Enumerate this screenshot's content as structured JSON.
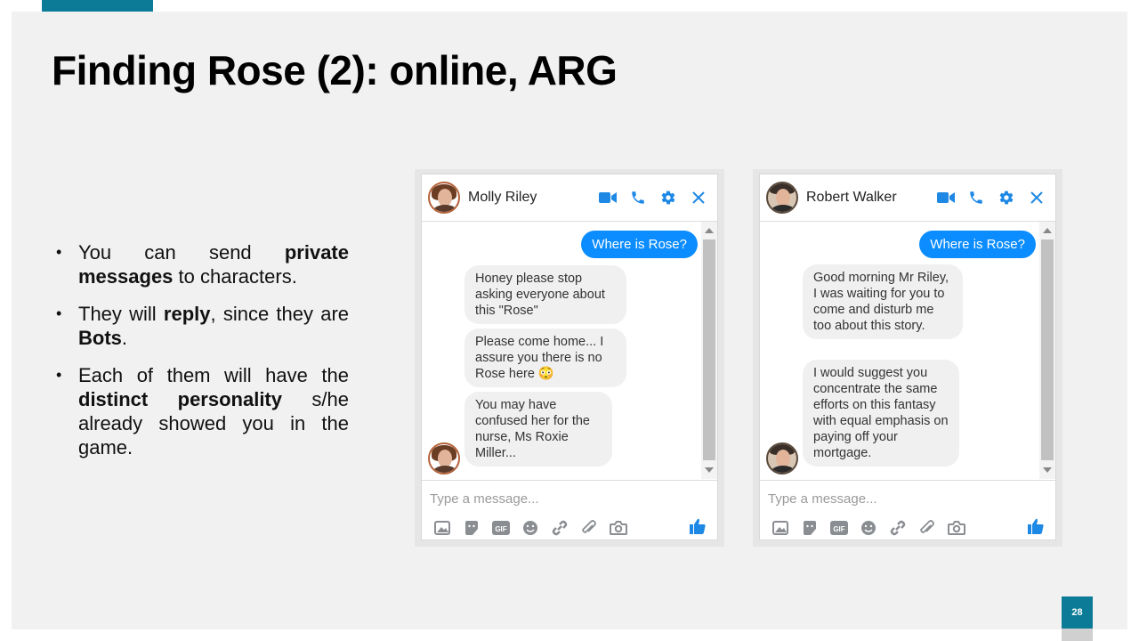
{
  "slide": {
    "title": "Finding Rose (2): online, ARG",
    "page_number": "28",
    "accent_color": "#0b7b97"
  },
  "bullets": [
    {
      "pre": "You can send ",
      "bold": "private messages",
      "post": " to characters."
    },
    {
      "pre": "They will ",
      "bold": "reply",
      "post": ", since they are ",
      "bold2": "Bots",
      "post2": "."
    },
    {
      "pre": "Each of them will have the ",
      "bold": "distinct personality",
      "post": " s/he already showed you in the game."
    }
  ],
  "chats": [
    {
      "contact": "Molly Riley",
      "outgoing": "Where is Rose?",
      "replies": [
        "Honey please stop asking everyone about this \"Rose\"",
        "Please come home... I assure you there is no Rose here 😳",
        "You may have confused her for the nurse, Ms Roxie Miller..."
      ],
      "placeholder": "Type a message...",
      "header_icons": [
        "video-icon",
        "phone-icon",
        "gear-icon",
        "close-icon"
      ],
      "toolbar_icons": [
        "image-icon",
        "sticker-icon",
        "gif-icon",
        "emoji-icon",
        "link-icon",
        "attach-icon",
        "camera-icon"
      ]
    },
    {
      "contact": "Robert Walker",
      "outgoing": "Where is Rose?",
      "replies": [
        "Good morning Mr Riley, I was waiting for you to come and disturb me too about this story.",
        "I would suggest you concentrate the same efforts on this fantasy with equal emphasis on paying off your mortgage."
      ],
      "placeholder": "Type a message...",
      "header_icons": [
        "video-icon",
        "phone-icon",
        "gear-icon",
        "close-icon"
      ],
      "toolbar_icons": [
        "image-icon",
        "sticker-icon",
        "gif-icon",
        "emoji-icon",
        "link-icon",
        "attach-icon",
        "camera-icon"
      ]
    }
  ],
  "colors": {
    "messenger_blue": "#0b8cff",
    "icon_blue": "#1e88e5"
  }
}
